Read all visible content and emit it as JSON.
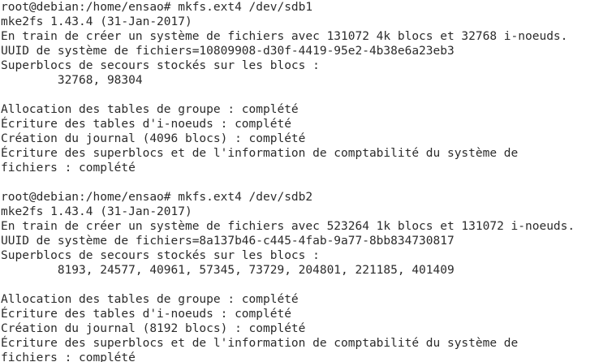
{
  "terminal": {
    "lines": [
      "root@debian:/home/ensao# mkfs.ext4 /dev/sdb1",
      "mke2fs 1.43.4 (31-Jan-2017)",
      "En train de créer un système de fichiers avec 131072 4k blocs et 32768 i-noeuds.",
      "UUID de système de fichiers=10809908-d30f-4419-95e2-4b38e6a23eb3",
      "Superblocs de secours stockés sur les blocs :",
      "        32768, 98304",
      "",
      "Allocation des tables de groupe : complété",
      "Écriture des tables d'i-noeuds : complété",
      "Création du journal (4096 blocs) : complété",
      "Écriture des superblocs et de l'information de comptabilité du système de",
      "fichiers : complété",
      "",
      "root@debian:/home/ensao# mkfs.ext4 /dev/sdb2",
      "mke2fs 1.43.4 (31-Jan-2017)",
      "En train de créer un système de fichiers avec 523264 1k blocs et 131072 i-noeuds.",
      "UUID de système de fichiers=8a137b46-c445-4fab-9a77-8bb834730817",
      "Superblocs de secours stockés sur les blocs :",
      "        8193, 24577, 40961, 57345, 73729, 204801, 221185, 401409",
      "",
      "Allocation des tables de groupe : complété",
      "Écriture des tables d'i-noeuds : complété",
      "Création du journal (8192 blocs) : complété",
      "Écriture des superblocs et de l'information de comptabilité du système de",
      "fichiers : complété"
    ]
  }
}
